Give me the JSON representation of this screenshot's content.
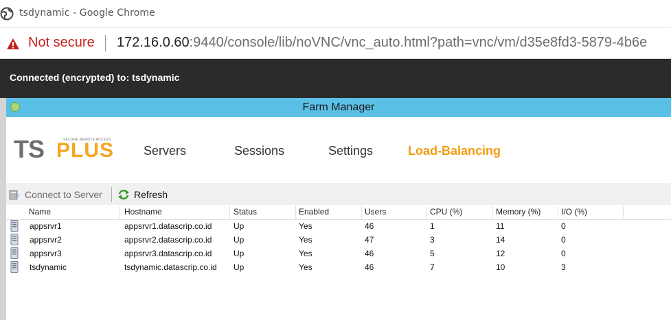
{
  "browser": {
    "window_title": "tsdynamic - Google Chrome",
    "security_label": "Not secure",
    "url_host": "172.16.0.60",
    "url_rest": ":9440/console/lib/noVNC/vnc_auto.html?path=vnc/vm/d35e8fd3-5879-4b6e"
  },
  "vnc": {
    "status": "Connected (encrypted) to: tsdynamic"
  },
  "farm": {
    "window_title": "Farm Manager",
    "logo_ts": "TS",
    "logo_plus": "PLUS",
    "logo_tagline": "SECURE REMOTE ACCESS",
    "nav": {
      "servers": "Servers",
      "sessions": "Sessions",
      "settings": "Settings",
      "load_balancing": "Load-Balancing"
    },
    "toolbar": {
      "connect": "Connect to Server",
      "refresh": "Refresh"
    },
    "columns": [
      "Name",
      "Hostname",
      "Status",
      "Enabled",
      "Users",
      "CPU (%)",
      "Memory (%)",
      "I/O (%)"
    ],
    "rows": [
      {
        "name": "appsrvr1",
        "hostname": "appsrvr1.datascrip.co.id",
        "status": "Up",
        "enabled": "Yes",
        "users": "46",
        "cpu": "1",
        "memory": "11",
        "io": "0"
      },
      {
        "name": "appsrvr2",
        "hostname": "appsrvr2.datascrip.co.id",
        "status": "Up",
        "enabled": "Yes",
        "users": "47",
        "cpu": "3",
        "memory": "14",
        "io": "0"
      },
      {
        "name": "appsrvr3",
        "hostname": "appsrvr3.datascrip.co.id",
        "status": "Up",
        "enabled": "Yes",
        "users": "46",
        "cpu": "5",
        "memory": "12",
        "io": "0"
      },
      {
        "name": "tsdynamic",
        "hostname": "tsdynamic.datascrip.co.id",
        "status": "Up",
        "enabled": "Yes",
        "users": "46",
        "cpu": "7",
        "memory": "10",
        "io": "3"
      }
    ]
  },
  "colors": {
    "title_bar": "#5bc0e6",
    "accent": "#f39c12",
    "vnc_bar": "#2b2b2b",
    "warning": "#c5221f"
  },
  "icons": [
    "globe-icon",
    "warning-icon",
    "app-icon",
    "connect-server-icon",
    "refresh-icon",
    "server-icon"
  ]
}
